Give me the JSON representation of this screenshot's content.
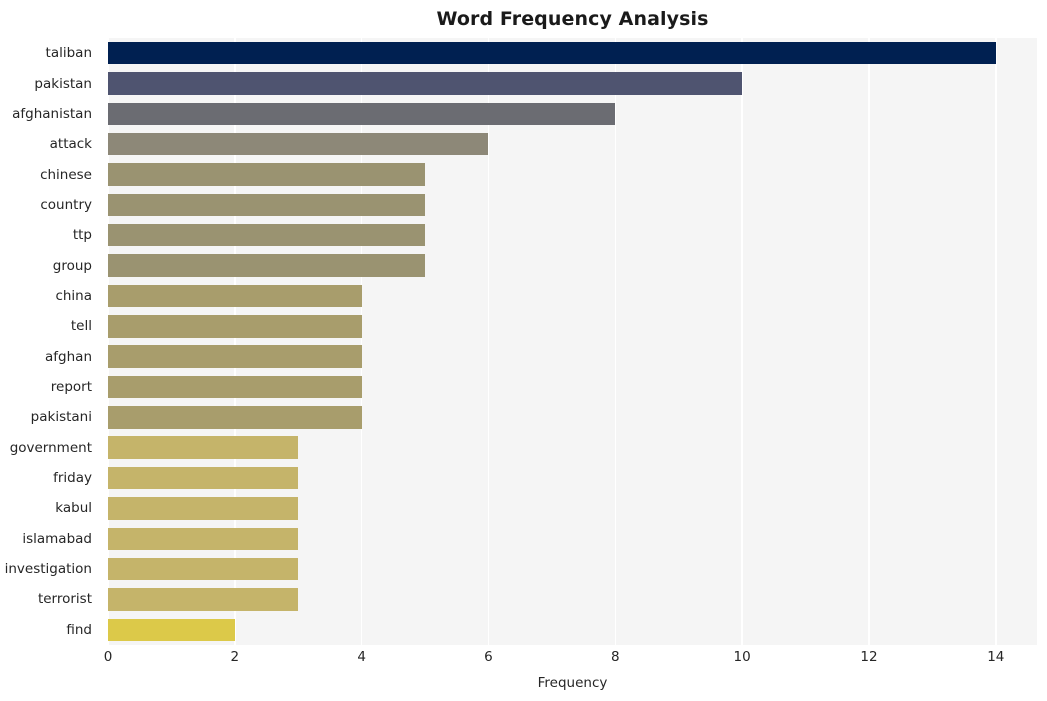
{
  "chart_data": {
    "type": "bar",
    "orientation": "horizontal",
    "title": "Word Frequency Analysis",
    "xlabel": "Frequency",
    "ylabel": "",
    "categories": [
      "taliban",
      "pakistan",
      "afghanistan",
      "attack",
      "chinese",
      "country",
      "ttp",
      "group",
      "china",
      "tell",
      "afghan",
      "report",
      "pakistani",
      "government",
      "friday",
      "kabul",
      "islamabad",
      "investigation",
      "terrorist",
      "find"
    ],
    "values": [
      14,
      10,
      8,
      6,
      5,
      5,
      5,
      5,
      4,
      4,
      4,
      4,
      4,
      3,
      3,
      3,
      3,
      3,
      3,
      2
    ],
    "bar_colors": [
      "#002051",
      "#4f5470",
      "#6b6c72",
      "#8d8878",
      "#9a9371",
      "#9a9371",
      "#9a9371",
      "#9a9371",
      "#a89d6c",
      "#a89d6c",
      "#a89d6c",
      "#a89d6c",
      "#a89d6c",
      "#c5b46a",
      "#c5b46a",
      "#c5b46a",
      "#c5b46a",
      "#c5b46a",
      "#c5b46a",
      "#dcc949"
    ],
    "xlim": [
      0,
      14.65
    ],
    "xticks": [
      0,
      2,
      4,
      6,
      8,
      10,
      12,
      14
    ],
    "xtick_labels": [
      "0",
      "2",
      "4",
      "6",
      "8",
      "10",
      "12",
      "14"
    ],
    "grid": true,
    "grid_axis": "x",
    "grid_color": "#ffffff",
    "plot_background": "#f5f5f5",
    "figure_background": "#ffffff",
    "legend": null
  }
}
